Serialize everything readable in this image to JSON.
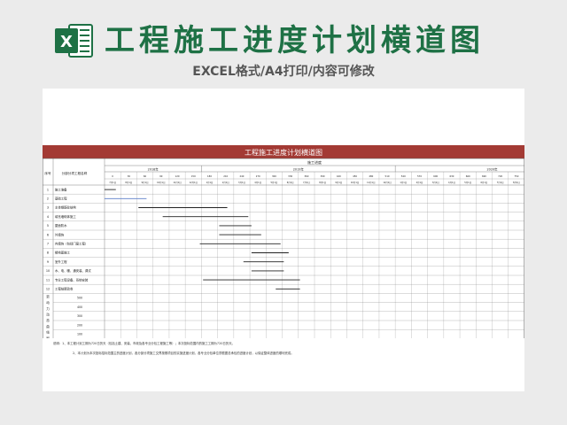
{
  "header": {
    "title": "工程施工进度计划横道图",
    "subtitle": "EXCEL格式/A4打印/内容可修改",
    "logo_letter": "X",
    "logo_color": "#1e7145"
  },
  "sheet": {
    "title": "工程施工进度计划横道图",
    "title_bg": "#a33a34",
    "col_seq": "序号",
    "col_item": "分部分项工程名称",
    "schedule_label": "施工进度",
    "years": [
      {
        "label": "2018年",
        "span": 6
      },
      {
        "label": "2019年",
        "span": 12
      },
      {
        "label": "2020年",
        "span": 12
      }
    ],
    "day_marks": [
      "0",
      "30",
      "60",
      "90",
      "120",
      "150",
      "180",
      "210",
      "240",
      "270",
      "300",
      "330",
      "360",
      "390",
      "420",
      "450",
      "480",
      "510",
      "540",
      "570",
      "600",
      "630",
      "660",
      "690",
      "720",
      "750"
    ],
    "month_marks": [
      "7月1日",
      "8月1日",
      "9月1日",
      "10月1日",
      "11月1日",
      "12月1日",
      "1月1日",
      "2月1日",
      "3月1日",
      "4月1日",
      "5月1日",
      "6月1日",
      "7月1日",
      "8月1日",
      "9月1日",
      "10月1日",
      "11月1日",
      "12月1日",
      "1月1日",
      "2月1日",
      "3月1日",
      "4月1日",
      "5月1日",
      "6月1日",
      "7月1日",
      "8月1日"
    ],
    "tasks": [
      {
        "no": "1",
        "name": "施工准备",
        "bar": [
          0,
          0.7
        ],
        "color": "#222222"
      },
      {
        "no": "2",
        "name": "基础工程",
        "bar": [
          0,
          2.6
        ],
        "color": "#5b7ec9"
      },
      {
        "no": "3",
        "name": "主体钢筋砼结构",
        "bar": [
          2.1,
          7.6
        ],
        "color": "#222222"
      },
      {
        "no": "4",
        "name": "填充墙砌体施工",
        "bar": [
          3.6,
          8.9
        ],
        "color": "#222222"
      },
      {
        "no": "5",
        "name": "屋面防水",
        "bar": [
          7.1,
          9.1
        ],
        "color": "#222222"
      },
      {
        "no": "6",
        "name": "外墙饰",
        "bar": [
          7.1,
          9.7
        ],
        "color": "#222222"
      },
      {
        "no": "7",
        "name": "内墙饰（包括门窗工程）",
        "bar": [
          5.9,
          10.9
        ],
        "color": "#222222"
      },
      {
        "no": "8",
        "name": "楼地面施工",
        "bar": [
          9.1,
          11.4
        ],
        "color": "#222222"
      },
      {
        "no": "9",
        "name": "室外工程",
        "bar": [
          8.6,
          11.1
        ],
        "color": "#222222"
      },
      {
        "no": "10",
        "name": "水、电、暖、通安装、调试",
        "bar": [
          9.1,
          11.1
        ],
        "color": "#222222"
      },
      {
        "no": "11",
        "name": "专业工程设备、系统安装",
        "bar": [
          6.1,
          12.1
        ],
        "color": "#222222"
      },
      {
        "no": "12",
        "name": "工程结尾验收",
        "bar": [
          10.6,
          12.1
        ],
        "color": "#222222"
      }
    ],
    "labor_label": "劳动力动态曲线图",
    "labor_values": [
      "500",
      "400",
      "300",
      "200",
      "100"
    ],
    "notes": [
      "说明：1、本工程计划工期为720日历天（包括土建、安装、市政及各专业分包工程施工等）；本次投标范围内的施工工期为720日历天。",
      "2、本计划为本次投标招标范围主的进度计划，各分部分项施工交界按照项目的实施进度计划，各专业分包单位须根据总承包的进度计划，以保证整体进度的顺利完成。"
    ]
  }
}
